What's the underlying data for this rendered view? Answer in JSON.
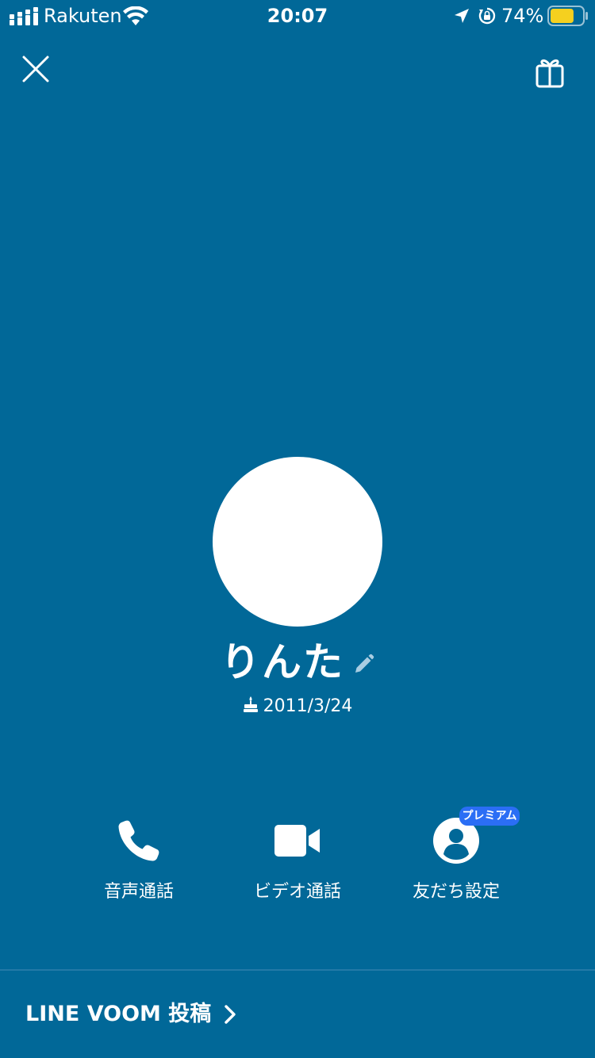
{
  "status_bar": {
    "carrier": "Rakuten",
    "time": "20:07",
    "battery_percent": "74%",
    "battery_level": 0.74,
    "battery_color": "#f5d01f"
  },
  "header": {
    "close_icon": "close-icon",
    "gift_icon": "gift-icon"
  },
  "profile": {
    "name": "りんた",
    "birthday": "2011/3/24",
    "avatar_color": "#ffffff"
  },
  "actions": [
    {
      "label": "音声通話",
      "icon": "phone-icon"
    },
    {
      "label": "ビデオ通話",
      "icon": "video-camera-icon"
    },
    {
      "label": "友だち設定",
      "icon": "person-icon",
      "badge": "プレミアム"
    }
  ],
  "footer": {
    "voom_label": "LINE VOOM 投稿"
  },
  "colors": {
    "background": "#016898",
    "badge": "#2b6ef5"
  }
}
